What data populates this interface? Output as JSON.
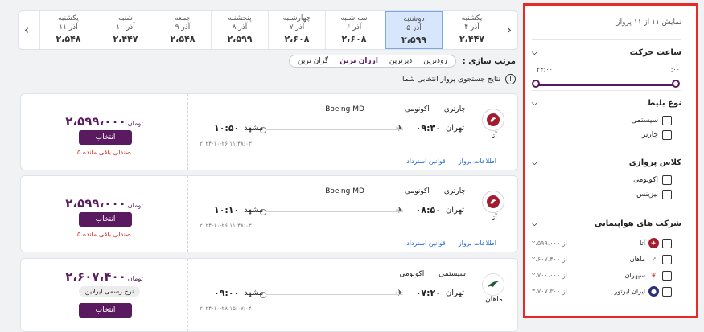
{
  "date_strip": {
    "prev_arrow": "‹",
    "next_arrow": "›",
    "days": [
      {
        "weekday": "یکشنبه",
        "date": "۱۱ آذر",
        "price": "۲،۵۴۸"
      },
      {
        "weekday": "شنبه",
        "date": "۱۰ آذر",
        "price": "۲،۴۴۷"
      },
      {
        "weekday": "جمعه",
        "date": "۹ آذر",
        "price": "۲،۵۴۸"
      },
      {
        "weekday": "پنجشنبه",
        "date": "۸ آذر",
        "price": "۲،۵۹۹"
      },
      {
        "weekday": "چهارشنبه",
        "date": "۷ آذر",
        "price": "۲،۶۰۸"
      },
      {
        "weekday": "سه شنبه",
        "date": "۶ آذر",
        "price": "۲،۶۰۸"
      },
      {
        "weekday": "دوشنبه",
        "date": "۵ آذر",
        "price": "۲،۵۹۹"
      },
      {
        "weekday": "یکشنبه",
        "date": "۴ آذر",
        "price": "۲،۴۴۷"
      }
    ]
  },
  "sort": {
    "label": "مرتب سازی :",
    "options": [
      "زودترین",
      "دیرترین",
      "ارزان ترین",
      "گران ترین"
    ]
  },
  "info_text": "نتایج جستجوی پرواز انتخابی شما",
  "flights": [
    {
      "airline": "آتا",
      "type": "چارتری",
      "class": "اکونومی",
      "aircraft": "Boeing MD",
      "origin": "تهران",
      "dep": "۰۹:۳۰",
      "dest": "مشهد",
      "arr": "۱۰:۵۰",
      "timestamp": "۲۰۲۴-۱۰-۲۶ ۱۱:۴۸:۰۳",
      "price": "۲،۵۹۹،۰۰۰",
      "currency": "تومان",
      "select": "انتخاب",
      "seats": "۵ صندلی باقی مانده",
      "link_info": "اطلاعات پرواز",
      "link_refund": "قوانین استرداد"
    },
    {
      "airline": "آتا",
      "type": "چارتری",
      "class": "اکونومی",
      "aircraft": "Boeing MD",
      "origin": "تهران",
      "dep": "۰۸:۵۰",
      "dest": "مشهد",
      "arr": "۱۰:۱۰",
      "timestamp": "۲۰۲۴-۱۰-۲۶ ۱۱:۴۸:۰۳",
      "price": "۲،۵۹۹،۰۰۰",
      "currency": "تومان",
      "select": "انتخاب",
      "seats": "۵ صندلی باقی مانده",
      "link_info": "اطلاعات پرواز",
      "link_refund": "قوانین استرداد"
    },
    {
      "airline": "ماهان",
      "type": "سیستمی",
      "class": "اکونومی",
      "aircraft": "",
      "origin": "تهران",
      "dep": "۰۷:۲۰",
      "dest": "مشهد",
      "arr": "۰۹:۰۰",
      "timestamp": "۲۰۲۴-۱۰-۲۸ ۱۵:۰۷:۰۴",
      "price": "۲،۶۰۷،۴۰۰",
      "currency": "تومان",
      "official": "نرخ رسمی ایرلاین",
      "select": "انتخاب"
    }
  ],
  "sidebar": {
    "count": "نمایش ۱۱ از ۱۱ پرواز",
    "departure_time": {
      "title": "ساعت حرکت",
      "min": "۰:۰۰",
      "max": "۲۴:۰۰"
    },
    "ticket_type": {
      "title": "نوع بلیط",
      "options": [
        "سیستمی",
        "چارتر"
      ]
    },
    "flight_class": {
      "title": "کلاس پروازی",
      "options": [
        "اکونومی",
        "بیزینس"
      ]
    },
    "airlines": {
      "title": "شرکت های هواپیمایی",
      "prefix": "از",
      "items": [
        {
          "name": "آتا",
          "price": "۲،۵۹۹،۰۰۰",
          "color": "#a21c2e"
        },
        {
          "name": "ماهان",
          "price": "۲،۶۰۷،۴۰۰",
          "color": "#1f5d3a"
        },
        {
          "name": "سپهران",
          "price": "۲،۷۰۰،۰۰۰",
          "color": "#e0434c"
        },
        {
          "name": "ایران ایرتور",
          "price": "۳،۷۰۷،۳۰۰",
          "color": "#2b2f7a"
        }
      ]
    }
  }
}
